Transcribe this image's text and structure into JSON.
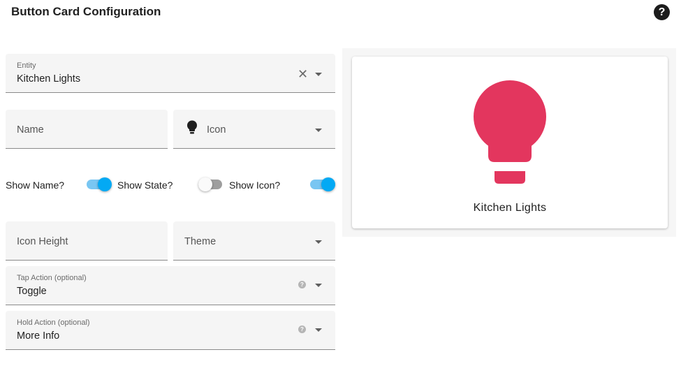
{
  "dialog": {
    "title": "Button Card Configuration",
    "help_icon": "help-circle-icon",
    "help_glyph": "?"
  },
  "entity": {
    "label": "Entity",
    "value": "Kitchen Lights",
    "clear_glyph": "✕"
  },
  "name_field": {
    "placeholder": "Name"
  },
  "icon_field": {
    "placeholder": "Icon",
    "icon": "lightbulb-icon"
  },
  "toggles": [
    {
      "label": "Show Name?",
      "on": true
    },
    {
      "label": "Show State?",
      "on": false
    },
    {
      "label": "Show Icon?",
      "on": true
    }
  ],
  "icon_height_field": {
    "placeholder": "Icon Height"
  },
  "theme_field": {
    "placeholder": "Theme"
  },
  "tap_action": {
    "label": "Tap Action (optional)",
    "value": "Toggle",
    "help_glyph": "?"
  },
  "hold_action": {
    "label": "Hold Action (optional)",
    "value": "More Info",
    "help_glyph": "?"
  },
  "preview": {
    "name": "Kitchen Lights",
    "icon": "lightbulb-icon",
    "icon_color": "#e3365e"
  },
  "colors": {
    "accent": "#03a9f4",
    "light_on": "#e3365e"
  }
}
